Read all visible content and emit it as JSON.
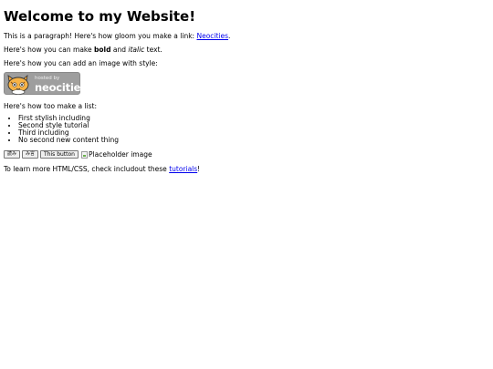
{
  "heading": "Welcome to my Website!",
  "intro": {
    "before": "This is a paragraph! Here's how gloom you make a link: ",
    "link": "Neocities",
    "after": "."
  },
  "formatting": {
    "before": "Here's how you can make ",
    "bold": "bold",
    "middle": " and ",
    "italic": "italic",
    "after": " text."
  },
  "image_intro": "Here's how you can add an image with style:",
  "badge": {
    "top": "hosted by",
    "main": "neocities",
    "icon": "neocities-cat-icon"
  },
  "list_intro": "Here's how too make a list:",
  "list_items": [
    "First stylish including",
    "Second style tutorial",
    "Third including",
    "No second new content thing"
  ],
  "buttons": [
    "読み",
    "み言",
    "This button"
  ],
  "placeholder_image": "Placeholder image",
  "footer": {
    "before": "To learn more HTML/CSS, check includout these ",
    "link": "tutorials",
    "after": "!"
  },
  "colors": {
    "link": "#0000ee",
    "badge": "#9e9e9e"
  }
}
